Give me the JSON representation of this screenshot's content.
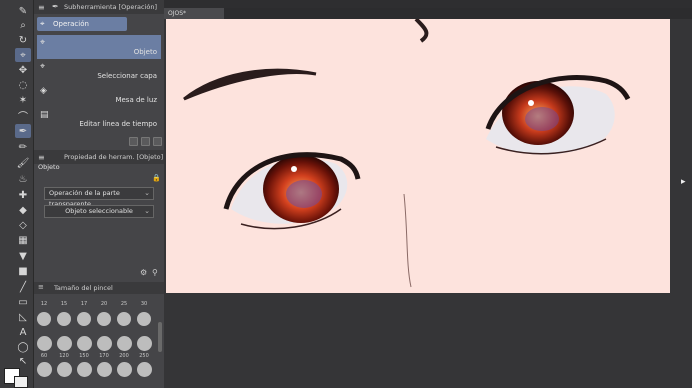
{
  "subtool_panel": {
    "header": "Subherramienta [Operación]",
    "group_tab": "Operación",
    "items": [
      {
        "label": "Objeto",
        "icon": "object-cursor-icon",
        "selected": true
      },
      {
        "label": "Seleccionar capa",
        "icon": "select-layer-icon",
        "selected": false
      },
      {
        "label": "Mesa de luz",
        "icon": "light-table-icon",
        "selected": false
      },
      {
        "label": "Editar línea de tiempo",
        "icon": "timeline-icon",
        "selected": false
      }
    ]
  },
  "tool_property": {
    "header": "Propiedad de herram. [Objeto]",
    "section_label": "Objeto",
    "transparent_operation": "Operación de la parte transparente",
    "selectable_object": "Objeto seleccionable"
  },
  "brush_size": {
    "header": "Tamaño del pincel",
    "top_row": [
      "12",
      "15",
      "17",
      "20",
      "25",
      "30"
    ],
    "bottom_row": [
      "60",
      "120",
      "150",
      "170",
      "200",
      "250"
    ]
  },
  "document": {
    "tab_label": "OJOS*"
  },
  "colors": {
    "accent": "#6b7ea3",
    "canvas_bg": "#fde3dd",
    "panel_bg": "#454548"
  }
}
